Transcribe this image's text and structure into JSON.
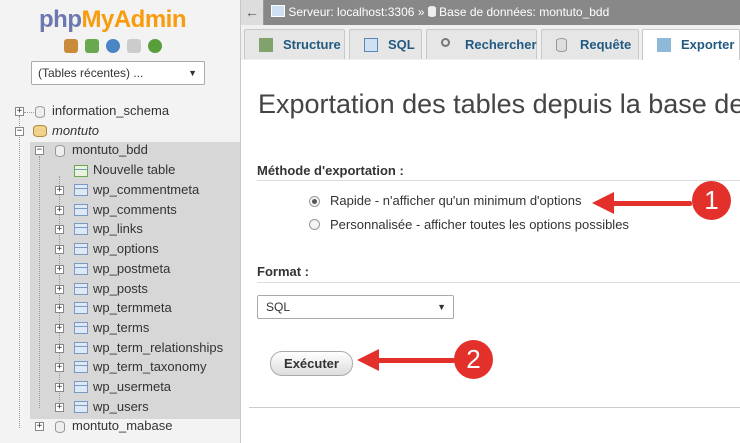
{
  "logo": {
    "php": "php",
    "admin": "MyAdmin"
  },
  "sidebar": {
    "recent_select": "(Tables récentes) ...",
    "databases": [
      {
        "name": "information_schema"
      },
      {
        "name": "montuto"
      },
      {
        "name": "montuto_bdd"
      },
      {
        "name": "montuto_mabase"
      }
    ],
    "new_table": "Nouvelle table",
    "tables": [
      "wp_commentmeta",
      "wp_comments",
      "wp_links",
      "wp_options",
      "wp_postmeta",
      "wp_posts",
      "wp_termmeta",
      "wp_terms",
      "wp_term_relationships",
      "wp_term_taxonomy",
      "wp_usermeta",
      "wp_users"
    ]
  },
  "topbar": {
    "server": "Serveur: localhost:3306",
    "separator": "»",
    "database": "Base de données: montuto_bdd"
  },
  "tabs": [
    {
      "label": "Structure"
    },
    {
      "label": "SQL"
    },
    {
      "label": "Rechercher"
    },
    {
      "label": "Requête"
    },
    {
      "label": "Exporter"
    }
  ],
  "main": {
    "title": "Exportation des tables depuis la base de",
    "method_label": "Méthode d'exportation :",
    "option_quick": "Rapide - n'afficher qu'un minimum d'options",
    "option_custom": "Personnalisée - afficher toutes les options possibles",
    "format_label": "Format :",
    "format_value": "SQL",
    "go_button": "Exécuter"
  },
  "callouts": [
    {
      "number": "1"
    },
    {
      "number": "2"
    }
  ],
  "colors": {
    "accent_red": "#e3302a",
    "tab_text": "#235a81",
    "logo_blue": "#6c78af",
    "logo_orange": "#f89c0e"
  }
}
